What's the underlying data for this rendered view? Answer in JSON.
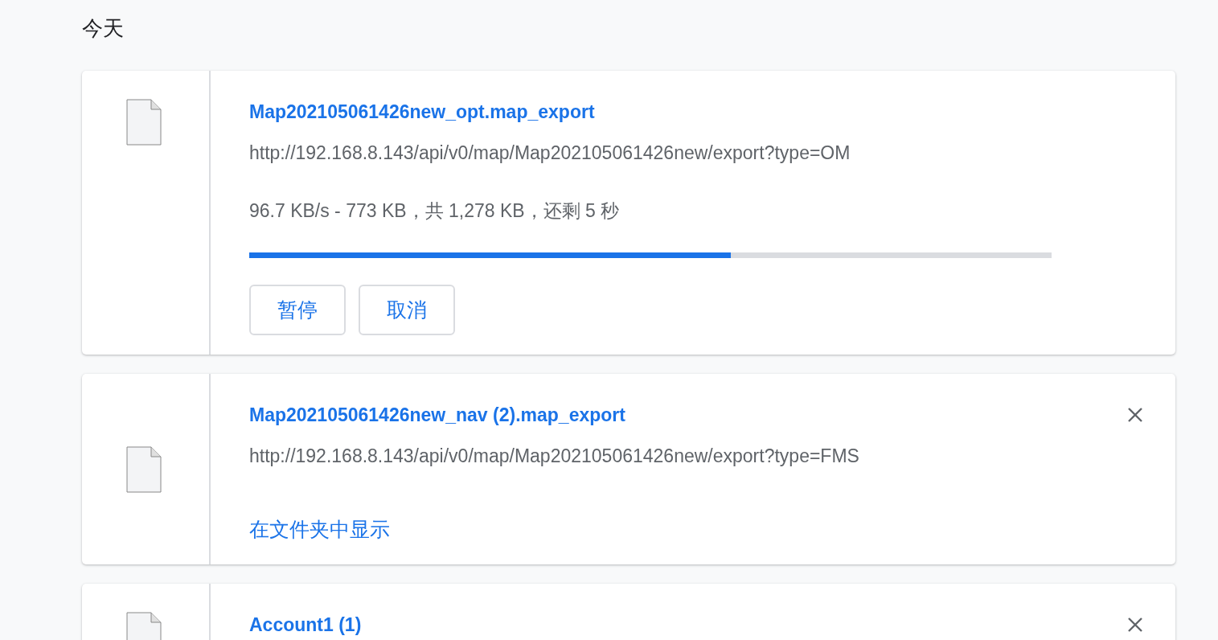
{
  "section_title": "今天",
  "downloads": [
    {
      "kind": "in_progress",
      "file_name": "Map202105061426new_opt.map_export",
      "url": "http://192.168.8.143/api/v0/map/Map202105061426new/export?type=OM",
      "status": "96.7 KB/s - 773 KB，共 1,278 KB，还剩 5 秒",
      "level": 0.6,
      "buttons": [
        "暂停",
        "取消"
      ]
    },
    {
      "kind": "complete",
      "file_name": "Map202105061426new_nav (2).map_export",
      "url": "http://192.168.8.143/api/v0/map/Map202105061426new/export?type=FMS",
      "link": "在文件夹中显示"
    },
    {
      "kind": "complete",
      "file_name": "Account1 (1)"
    }
  ]
}
